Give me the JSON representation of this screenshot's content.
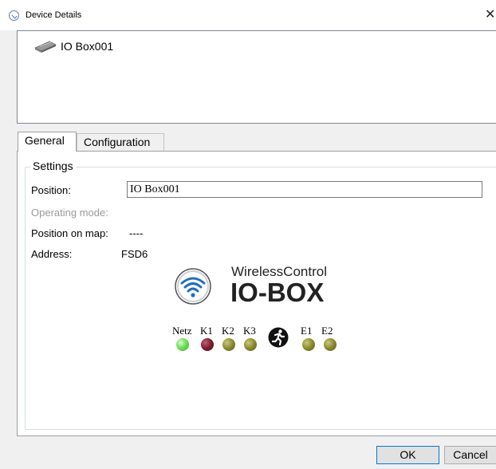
{
  "window": {
    "title": "Device Details",
    "close_glyph": "✕"
  },
  "tree": {
    "items": [
      {
        "label": "IO Box001",
        "icon": "io-box-device-icon"
      }
    ]
  },
  "tabs": [
    {
      "label": "General",
      "active": true
    },
    {
      "label": "Configuration",
      "active": false
    }
  ],
  "settings": {
    "legend": "Settings",
    "position_label": "Position:",
    "position_value": "IO Box001",
    "operating_mode_label": "Operating mode:",
    "position_on_map_label": "Position on map:",
    "position_on_map_value": "----",
    "address_label": "Address:",
    "address_value": "FSD6"
  },
  "logo": {
    "brand": "WirelessControl",
    "product": "IO-BOX",
    "icon": "wifi-icon"
  },
  "leds": [
    {
      "label": "Netz",
      "state": "green",
      "color": "#6fe05a"
    },
    {
      "label": "K1",
      "state": "red",
      "color": "#7a1f2a"
    },
    {
      "label": "K2",
      "state": "olive",
      "color": "#8a8a2a"
    },
    {
      "label": "K3",
      "state": "olive",
      "color": "#8a8a2a"
    },
    {
      "label": "E1",
      "state": "olive",
      "color": "#8a8a2a"
    },
    {
      "label": "E2",
      "state": "olive",
      "color": "#8a8a2a"
    }
  ],
  "buttons": {
    "ok": "OK",
    "cancel": "Cancel"
  }
}
